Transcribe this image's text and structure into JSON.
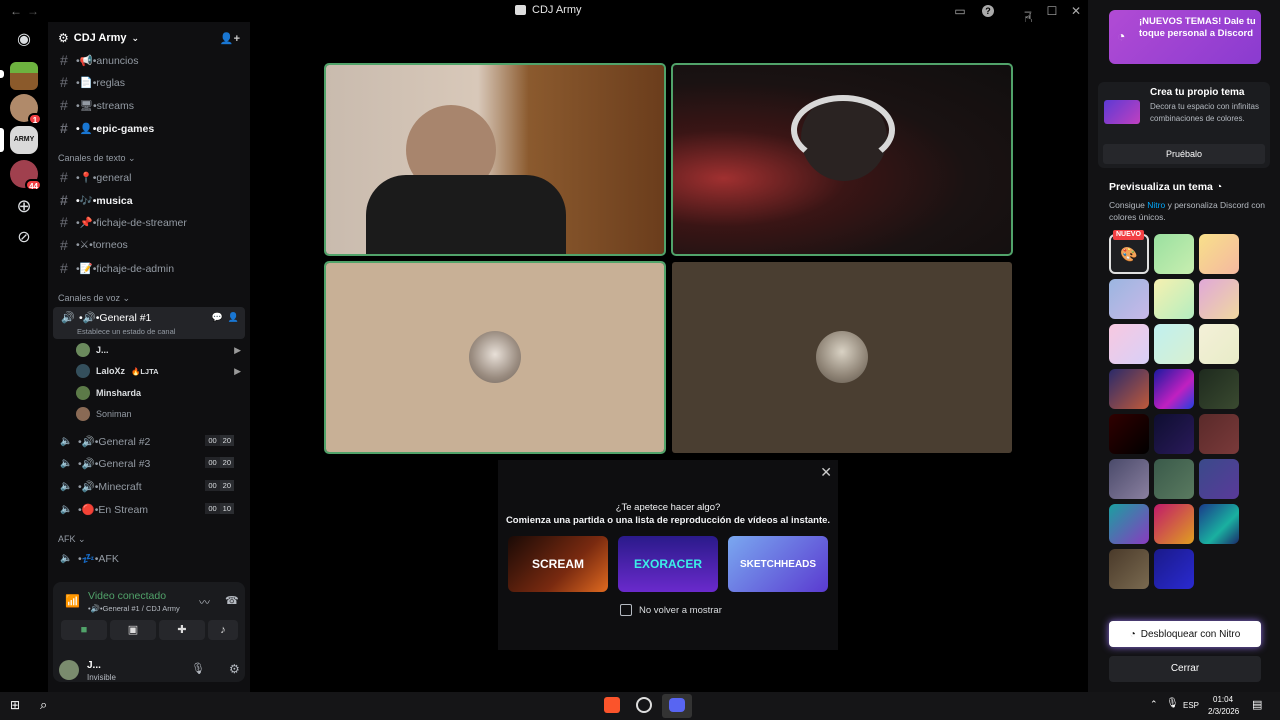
{
  "window": {
    "title": "CDJ Army"
  },
  "server": {
    "name": "CDJ Army"
  },
  "channels_top": [
    {
      "label": "•📢•anuncios",
      "unread": false
    },
    {
      "label": "•📄•reglas",
      "unread": false
    },
    {
      "label": "•🖥•streams",
      "unread": false
    },
    {
      "label": "•👤•epic-games",
      "unread": true
    }
  ],
  "cat_text": "Canales de texto",
  "channels_text": [
    {
      "label": "•📍•general",
      "unread": false
    },
    {
      "label": "•🎶•musica",
      "unread": true
    },
    {
      "label": "•📌•fichaje-de-streamer",
      "unread": false
    },
    {
      "label": "•⚔•torneos",
      "unread": false
    },
    {
      "label": "•📝•fichaje-de-admin",
      "unread": false
    }
  ],
  "cat_voice": "Canales de voz",
  "voice_active": {
    "label": "•🔊•General #1",
    "status": "Establece un estado de canal"
  },
  "voice_users": [
    {
      "name": "J...",
      "tag": ""
    },
    {
      "name": "LaloXz",
      "tag": "🔥LJTA"
    },
    {
      "name": "Minsharda",
      "tag": ""
    },
    {
      "name": "Soniman",
      "tag": ""
    }
  ],
  "voice_channels": [
    {
      "label": "•🔊•General #2",
      "a": "00",
      "b": "20"
    },
    {
      "label": "•🔊•General #3",
      "a": "00",
      "b": "20"
    },
    {
      "label": "•🔊•Minecraft",
      "a": "00",
      "b": "20"
    },
    {
      "label": "•🔴•En Stream",
      "a": "00",
      "b": "10"
    }
  ],
  "cat_afk": "AFK",
  "afk_channel": "•💤•AFK",
  "rail_badges": [
    "1",
    "44"
  ],
  "vpanel": {
    "status": "Video conectado",
    "sub": "•🔊•General #1 / CDJ Army"
  },
  "account": {
    "name": "J...",
    "status": "Invisible"
  },
  "activity": {
    "q": "¿Te apetece hacer algo?",
    "desc": "Comienza una partida o una lista de reproducción de vídeos al instante.",
    "games": [
      "SCREAM",
      "EXORACER",
      "SKETCHHEADS"
    ],
    "checkbox": "No volver a mostrar"
  },
  "panel": {
    "banner": "¡NUEVOS TEMAS! Dale tu toque personal a Discord",
    "create_title": "Crea tu propio tema",
    "create_desc": "Decora tu espacio con infinitas combinaciones de colores.",
    "try": "Pruébalo",
    "preview_title": "Previsualiza un tema",
    "preview_desc_pre": "Consigue ",
    "preview_link": "Nitro",
    "preview_desc_post": " y personaliza Discord con colores únicos.",
    "new_tag": "NUEVO",
    "unlock": "Desbloquear con Nitro",
    "close": "Cerrar"
  },
  "tray": {
    "lang": "ESP",
    "time": "01:04",
    "date": "2/3/2026"
  },
  "colors": {
    "speaking": "#51a36a",
    "nitro": "#b14bd4",
    "brand": "#5865f2"
  }
}
